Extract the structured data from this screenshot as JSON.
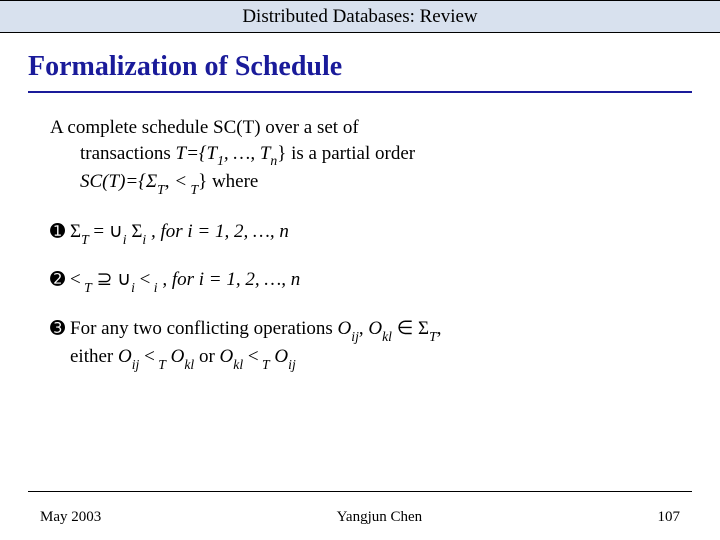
{
  "header": {
    "title": "Distributed Databases: Review"
  },
  "slide": {
    "title": "Formalization of Schedule",
    "intro_l1": "A complete schedule SC(T) over a set of",
    "intro_l2_pre": "transactions ",
    "intro_set": "T={T",
    "intro_set_sub1": "1",
    "intro_set_mid": ", …, T",
    "intro_set_subn": "n",
    "intro_set_post": "} is a partial order",
    "intro_l3": "SC(T)={Σ",
    "intro_l3_subT": "T",
    "intro_l3_mid": ", <",
    "intro_l3_sub2": " T",
    "intro_l3_end": "} where",
    "b1_num": "➊",
    "b1_a": "Σ",
    "b1_aSubT": "T",
    "b1_eq": " = ∪",
    "b1_eq_sub": "i",
    "b1_sig": " Σ",
    "b1_sig_sub": "i",
    "b1_for": "   , for  i = 1, 2, …, n",
    "b2_num": "➋",
    "b2_a": "<",
    "b2_aSubT": " T",
    "b2_sup": " ⊇ ∪",
    "b2_sup_sub": "i",
    "b2_lt": " <",
    "b2_lt_sub": " i",
    "b2_for": " , for  i = 1, 2, …, n",
    "b3_num": "➌",
    "b3_l1_a": "For any two conflicting operations ",
    "b3_O1": "O",
    "b3_O1_sub": "ij",
    "b3_comma": ", ",
    "b3_O2": "O",
    "b3_O2_sub": "kl",
    "b3_in": " ∈ Σ",
    "b3_in_sub": "T",
    "b3_comma2": ",",
    "b3_l2_a": "either ",
    "b3_Oij2": "O",
    "b3_Oij2_sub": "ij",
    "b3_lt1": " <",
    "b3_lt1_sub": " T",
    "b3_sp1": " ",
    "b3_Okl2": "O",
    "b3_Okl2_sub": "kl",
    "b3_or": " or ",
    "b3_Okl3": "O",
    "b3_Okl3_sub": "kl",
    "b3_lt2": " <",
    "b3_lt2_sub": " T",
    "b3_sp2": " ",
    "b3_Oij3": "O",
    "b3_Oij3_sub": "ij"
  },
  "footer": {
    "date": "May 2003",
    "author": "Yangjun Chen",
    "page": "107"
  }
}
